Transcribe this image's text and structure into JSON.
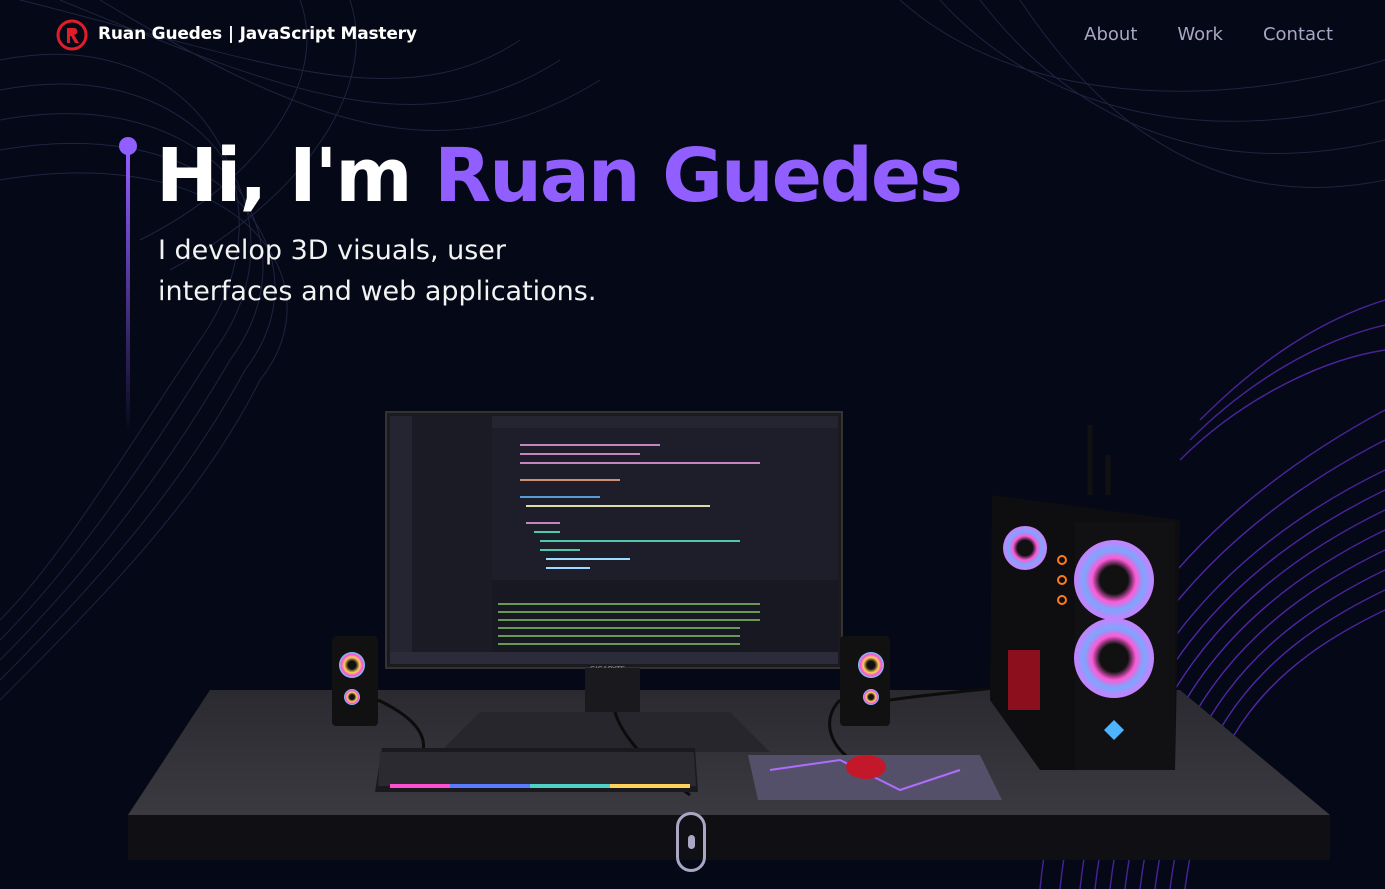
{
  "nav": {
    "brand_name": "Ruan Guedes",
    "brand_suffix": "| JavaScript Mastery",
    "links": [
      {
        "label": "About"
      },
      {
        "label": "Work"
      },
      {
        "label": "Contact"
      }
    ]
  },
  "hero": {
    "greeting": "Hi, I'm",
    "name": "Ruan Guedes",
    "subtitle_line1": "I develop 3D visuals, user",
    "subtitle_line2": "interfaces and web applications."
  },
  "scene": {
    "monitor_brand": "GIGABYTE"
  },
  "colors": {
    "background": "#050816",
    "accent": "#915eff",
    "nav_text": "#aaa6c3",
    "logo_red": "#e11d2a"
  },
  "icons": {
    "logo": "logo-icon",
    "scroll": "scroll-mouse-icon"
  }
}
